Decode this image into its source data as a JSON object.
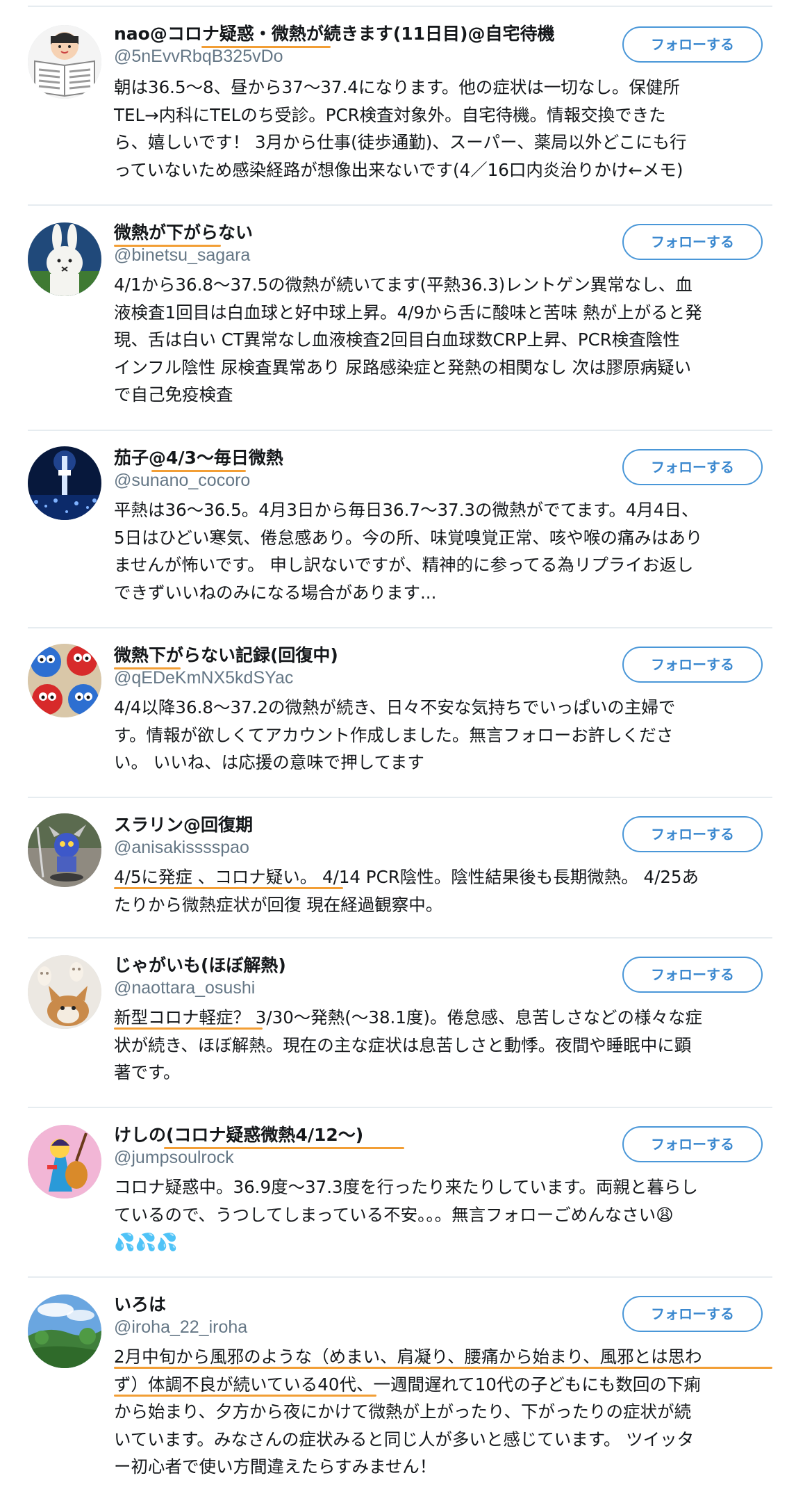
{
  "follow_label": "フォローする",
  "accent_color": "#4a97d8",
  "highlight_color": "#f29e35",
  "users": [
    {
      "name": "nao@コロナ疑惑・微熱が続きます(11日目)@自宅待機",
      "handle": "@5nEvvRbqB325vDo",
      "bio": [
        "朝は36.5〜8、昼から37〜37.4になります。他の症状は一切なし。保健所",
        "TEL→内科にTELのち受診。PCR検査対象外。自宅待機。情報交換できた",
        "ら、嬉しいです！ 3月から仕事(徒歩通勤)、スーパー、薬局以外どこにも行",
        "っていないため感染経路が想像出来ないです(4／16口内炎治りかけ←メモ)"
      ],
      "avatar": "newspaper-reader-icon"
    },
    {
      "name": "微熱が下がらない",
      "handle": "@binetsu_sagara",
      "bio": [
        "4/1から36.8〜37.5の微熱が続いてます(平熱36.3)レントゲン異常なし、血",
        "液検査1回目は白血球と好中球上昇。4/9から舌に酸味と苦味 熱が上がると発",
        "現、舌は白い CT異常なし血液検査2回目白血球数CRP上昇、PCR検査陰性",
        "インフル陰性 尿検査異常あり 尿路感染症と発熱の相関なし 次は膠原病疑い",
        "で自己免疫検査"
      ],
      "avatar": "white-rabbit-icon"
    },
    {
      "name": "茄子@4/3〜毎日微熱",
      "handle": "@sunano_cocoro",
      "bio": [
        "平熱は36〜36.5。4月3日から毎日36.7〜37.3の微熱がでてます。4月4日、",
        "5日はひどい寒気、倦怠感あり。今の所、味覚嗅覚正常、咳や喉の痛みはあり",
        "ませんが怖いです。 申し訳ないですが、精神的に参ってる為リプライお返し",
        "できずいいねのみになる場合があります..."
      ],
      "avatar": "night-tower-icon"
    },
    {
      "name": "微熱下がらない記録(回復中)",
      "handle": "@qEDeKmNX5kdSYac",
      "bio": [
        "4/4以降36.8〜37.2の微熱が続き、日々不安な気持ちでいっぱいの主婦で",
        "す。情報が欲しくてアカウント作成しました。無言フォローお許しくださ",
        "い。 いいね、は応援の意味で押してます"
      ],
      "avatar": "cookies-icon"
    },
    {
      "name": "スラリン@回復期",
      "handle": "@anisakisssspao",
      "bio": [
        "4/5に発症 、コロナ疑い。 4/14 PCR陰性。陰性結果後も長期微熱。 4/25あ",
        "たりから微熱症状が回復 現在経過観察中。"
      ],
      "avatar": "knight-figure-icon"
    },
    {
      "name": "じゃがいも(ほぼ解熱)",
      "handle": "@naottara_osushi",
      "bio": [
        "新型コロナ軽症？ 3/30〜発熱(〜38.1度)。倦怠感、息苦しさなどの様々な症",
        "状が続き、ほぼ解熱。現在の主な症状は息苦しさと動悸。夜間や睡眠中に顕",
        "著です。"
      ],
      "avatar": "dog-icon"
    },
    {
      "name": "けしの(コロナ疑惑微熱4/12〜)",
      "handle": "@jumpsoulrock",
      "bio": [
        "コロナ疑惑中。36.9度〜37.3度を行ったり来たりしています。両親と暮らし",
        "ているので、うつしてしまっている不安。。。無言フォローごめんなさい😩",
        "💦💦💦"
      ],
      "avatar": "cartoon-musician-icon"
    },
    {
      "name": "いろは",
      "handle": "@iroha_22_iroha",
      "bio": [
        "2月中旬から風邪のような（めまい、肩凝り、腰痛から始まり、風邪とは思わ",
        "ず）体調不良が続いている40代、一週間遅れて10代の子どもにも数回の下痢",
        "から始まり、夕方から夜にかけて微熱が上がったり、下がったりの症状が続",
        "いています。みなさんの症状みると同じ人が多いと感じています。 ツイッタ",
        "ー初心者で使い方間違えたらすみません！"
      ],
      "avatar": "landscape-icon"
    }
  ]
}
